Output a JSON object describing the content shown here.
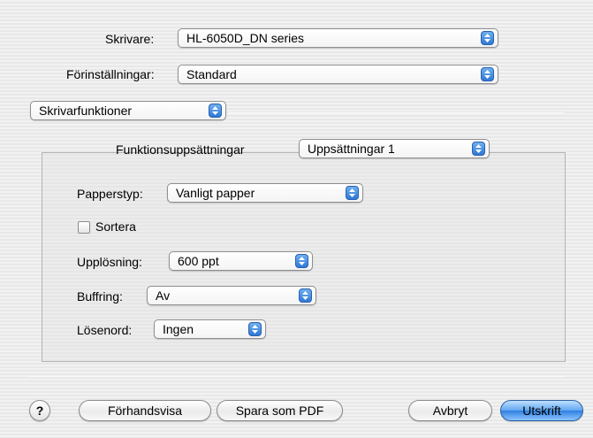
{
  "printer": {
    "label": "Skrivare:",
    "value": "HL-6050D_DN series"
  },
  "presets": {
    "label": "Förinställningar:",
    "value": "Standard"
  },
  "panel": {
    "value": "Skrivarfunktioner"
  },
  "feature_sets": {
    "label": "Funktionsuppsättningar",
    "value": "Uppsättningar 1"
  },
  "paper_type": {
    "label": "Papperstyp:",
    "value": "Vanligt papper"
  },
  "collate": {
    "label": "Sortera",
    "checked": false
  },
  "resolution": {
    "label": "Upplösning:",
    "value": "600 ppt"
  },
  "buffering": {
    "label": "Buffring:",
    "value": "Av"
  },
  "password": {
    "label": "Lösenord:",
    "value": "Ingen"
  },
  "buttons": {
    "help": "?",
    "preview": "Förhandsvisa",
    "save_pdf": "Spara som PDF",
    "cancel": "Avbryt",
    "print": "Utskrift"
  },
  "colors": {
    "accent": "#3a84e6"
  }
}
